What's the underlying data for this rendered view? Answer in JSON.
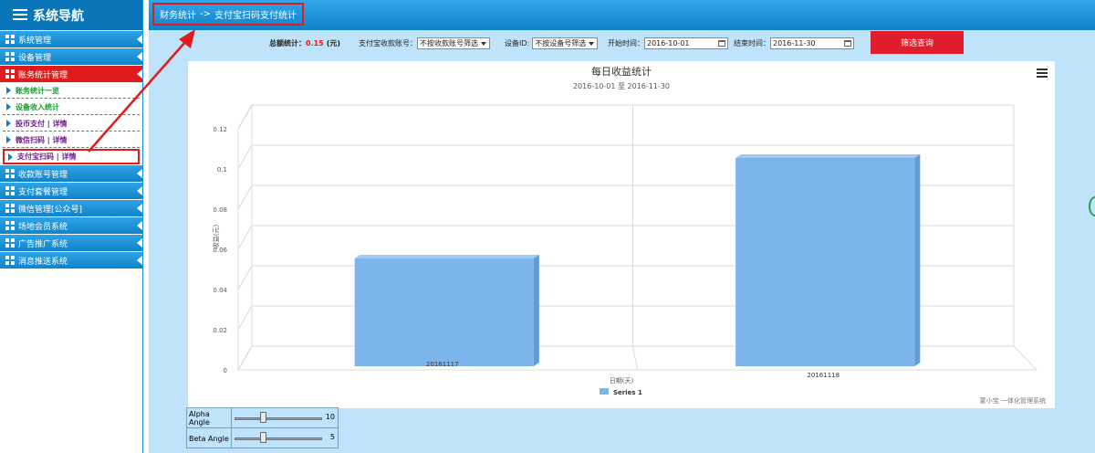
{
  "sidebar": {
    "title": "系统导航",
    "items": [
      {
        "label": "系统管理"
      },
      {
        "label": "设备管理"
      },
      {
        "label": "账务统计管理",
        "active": true
      }
    ],
    "subitems": [
      {
        "label": "账务统计一览",
        "color": "green"
      },
      {
        "label": "设备收入统计",
        "color": "green"
      },
      {
        "label": "投币支付 | 详情",
        "color": "purple"
      },
      {
        "label": "微信扫码 | 详情",
        "color": "purple"
      },
      {
        "label": "支付宝扫码 | 详情",
        "color": "purple",
        "current": true
      }
    ],
    "items_after": [
      {
        "label": "收款账号管理"
      },
      {
        "label": "支付套餐管理"
      },
      {
        "label": "微信管理[公众号]"
      },
      {
        "label": "场地会员系统"
      },
      {
        "label": "广告推广系统"
      },
      {
        "label": "消息推送系统"
      }
    ]
  },
  "breadcrumb": {
    "parent": "财务统计",
    "separator": "->",
    "current": "支付宝扫码支付统计"
  },
  "filters": {
    "total_label": "总额统计：",
    "total_value": "0.15",
    "total_unit": "(元)",
    "account_label": "支付宝收款账号：",
    "account_select": "不按收款账号筛选",
    "device_label": "设备ID:",
    "device_select": "不按设备号筛选",
    "start_label": "开始时间：",
    "start_value": "2016-10-01",
    "end_label": "结束时间：",
    "end_value": "2016-11-30",
    "button": "筛选查询"
  },
  "chart_data": {
    "type": "bar",
    "title": "每日收益统计",
    "subtitle": "2016-10-01 至 2016-11-30",
    "xlabel": "日期(天)",
    "ylabel": "收益(元)",
    "categories": [
      "20161117",
      "20161118"
    ],
    "series": [
      {
        "name": "Series 1",
        "values": [
          0.05,
          0.1
        ],
        "color": "#7cb5ec"
      }
    ],
    "ylim": [
      0,
      0.12
    ],
    "yticks": [
      "0",
      "0.02",
      "0.04",
      "0.06",
      "0.08",
      "0.1",
      "0.12"
    ],
    "grid": true,
    "legend": "bottom-center",
    "credits": "蒙小宝 一体化管理系统",
    "three_d": true
  },
  "angles": {
    "alpha_label": "Alpha Angle",
    "alpha_value": "10",
    "beta_label": "Beta Angle",
    "beta_value": "5"
  },
  "colors": {
    "nav_blue": "#0e82c9",
    "active_red": "#e01b1b",
    "button_red": "#e11d2c",
    "panel_bg": "#bfe3fb",
    "bar": "#7cb5ec"
  }
}
